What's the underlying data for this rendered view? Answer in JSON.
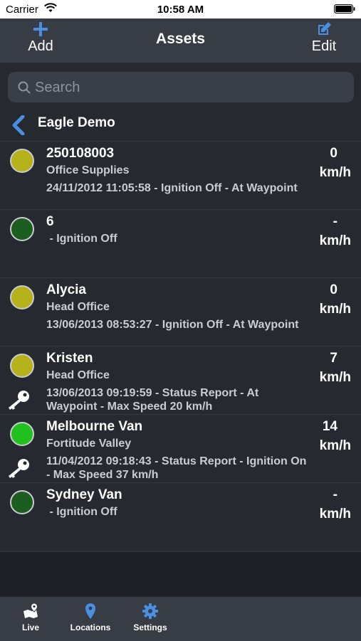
{
  "status_bar": {
    "carrier": "Carrier",
    "time": "10:58 AM"
  },
  "nav": {
    "add_label": "Add",
    "title": "Assets",
    "edit_label": "Edit"
  },
  "search": {
    "placeholder": "Search"
  },
  "group": {
    "title": "Eagle Demo"
  },
  "colors": {
    "accent": "#4a90e2",
    "status_yellow": "#b5b21a",
    "status_dark_green": "#1b5e20",
    "status_green": "#22c01f"
  },
  "assets": [
    {
      "name": "250108003",
      "location": "Office Supplies",
      "event": "24/11/2012 11:05:58 - Ignition Off - At Waypoint",
      "speed": "0",
      "unit": "km/h",
      "status": "yellow",
      "key": false
    },
    {
      "name": "6",
      "location": "",
      "event": " - Ignition Off",
      "speed": "-",
      "unit": "km/h",
      "status": "dark-green",
      "key": false
    },
    {
      "name": "Alycia",
      "location": "Head Office",
      "event": "13/06/2013 08:53:27 - Ignition Off - At Waypoint",
      "speed": "0",
      "unit": "km/h",
      "status": "yellow",
      "key": false
    },
    {
      "name": "Kristen",
      "location": "Head Office",
      "event": "13/06/2013 09:19:59 - Status Report - At Waypoint - Max Speed 20 km/h",
      "speed": "7",
      "unit": "km/h",
      "status": "yellow",
      "key": true
    },
    {
      "name": "Melbourne Van",
      "location": "Fortitude Valley",
      "event": "11/04/2012 09:18:43 - Status Report - Ignition On - Max Speed 37 km/h",
      "speed": "14",
      "unit": "km/h",
      "status": "green",
      "key": true
    },
    {
      "name": "Sydney Van",
      "location": "",
      "event": " - Ignition Off",
      "speed": "-",
      "unit": "km/h",
      "status": "dark-green",
      "key": false
    }
  ],
  "tabs": [
    {
      "label": "Live",
      "icon": "live-map-icon"
    },
    {
      "label": "Locations",
      "icon": "location-pin-icon"
    },
    {
      "label": "Settings",
      "icon": "gear-icon"
    }
  ]
}
